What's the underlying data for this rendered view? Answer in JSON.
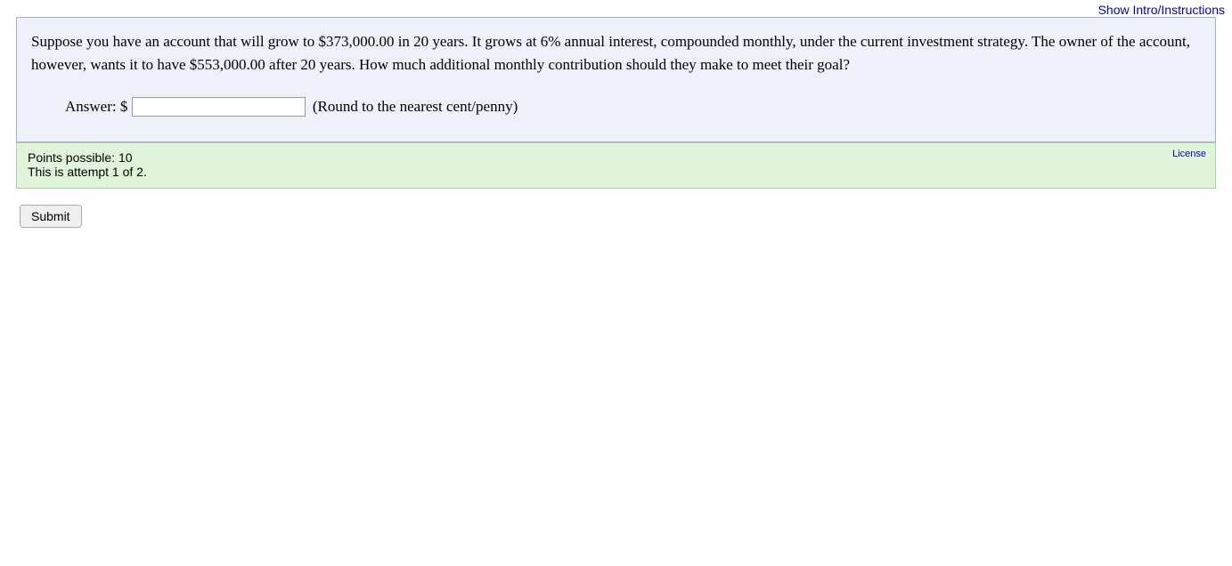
{
  "header": {
    "show_intro_link": "Show Intro/Instructions"
  },
  "question": {
    "prompt": "Suppose you have an account that will grow to $373,000.00 in 20 years. It grows at 6% annual interest, compounded monthly, under the current investment strategy. The owner of the account, however, wants it to have $553,000.00 after 20 years. How much additional monthly contribution should they make to meet their goal?",
    "answer_label": "Answer: $",
    "answer_value": "",
    "answer_hint": "(Round to the nearest cent/penny)"
  },
  "meta": {
    "points_line": "Points possible: 10",
    "attempt_line": "This is attempt 1 of 2.",
    "license_label": "License"
  },
  "actions": {
    "submit_label": "Submit"
  }
}
